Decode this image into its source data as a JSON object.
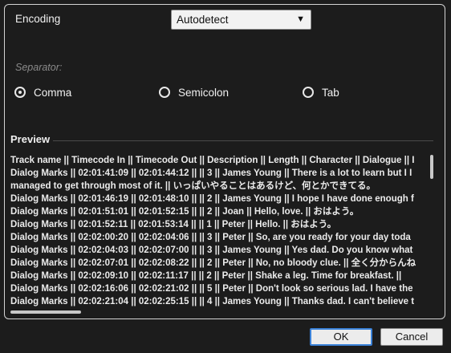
{
  "encoding": {
    "label": "Encoding",
    "selected": "Autodetect",
    "dropdown_icon": "triangle-down-icon"
  },
  "separator": {
    "label": "Separator:",
    "options": [
      "Comma",
      "Semicolon",
      "Tab"
    ],
    "selected": "Comma"
  },
  "preview": {
    "title": "Preview",
    "rows": [
      "Track name  ||  Timecode In  ||  Timecode Out  ||  Description  ||  Length  ||  Character  ||  Dialogue  ||  I",
      "Dialog Marks  ||  02:01:41:09  ||  02:01:44:12  ||    ||  3  ||  James Young  ||  There is a lot to learn but I I",
      " managed to get through most of it.  ||  いっぱいやることはあるけど、何とかできてる。",
      "Dialog Marks  ||  02:01:46:19  ||  02:01:48:10  ||    ||  2  ||  James Young  ||  I hope I have done enough f",
      "Dialog Marks  ||  02:01:51:01  ||  02:01:52:15  ||    ||  2  ||  Joan  ||  Hello, love.  ||  おはよう。",
      "Dialog Marks  ||  02:01:52:11  ||  02:01:53:14  ||    ||  1  ||  Peter  ||  Hello.  ||  おはよう。",
      "Dialog Marks  ||  02:02:00:20  ||  02:02:04:06  ||    ||  3  ||  Peter  ||  So, are you ready for your day toda",
      "Dialog Marks  ||  02:02:04:03  ||  02:02:07:00  ||    ||  3  ||  James Young  ||  Yes dad. Do you know what",
      "Dialog Marks  ||  02:02:07:01  ||  02:02:08:22  ||    ||  2  ||  Peter  ||  No, no bloody clue.  ||  全く分からんね",
      "Dialog Marks  ||  02:02:09:10  ||  02:02:11:17  ||    ||  2  ||  Peter  ||  Shake a leg. Time for breakfast.  ||",
      "Dialog Marks  ||  02:02:16:06  ||  02:02:21:02  ||    ||  5  ||  Peter  ||  Don't look so serious lad. I have the",
      "Dialog Marks  ||  02:02:21:04  ||  02:02:25:15  ||    ||  4  ||  James Young  ||  Thanks dad. I can't believe t"
    ]
  },
  "buttons": {
    "ok": "OK",
    "cancel": "Cancel"
  }
}
